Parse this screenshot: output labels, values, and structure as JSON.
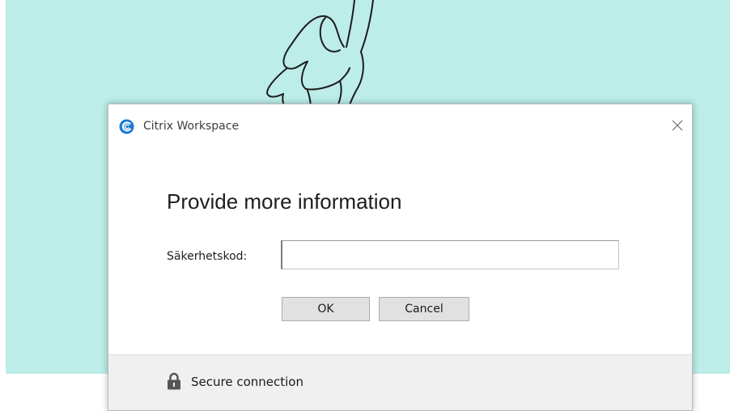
{
  "window": {
    "app_title": "Citrix Workspace",
    "app_icon": "citrix-workspace-icon",
    "close_icon": "close-icon"
  },
  "form": {
    "heading": "Provide more information",
    "field_label": "Säkerhetskod:",
    "field_value": ""
  },
  "buttons": {
    "ok_label": "OK",
    "cancel_label": "Cancel"
  },
  "footer": {
    "text": "Secure connection",
    "icon": "lock-icon"
  },
  "colors": {
    "backdrop": "#bcede9",
    "citrix_blue": "#1c7bd6",
    "button_face": "#e1e1e1",
    "footer_bg": "#f0f0f0"
  }
}
